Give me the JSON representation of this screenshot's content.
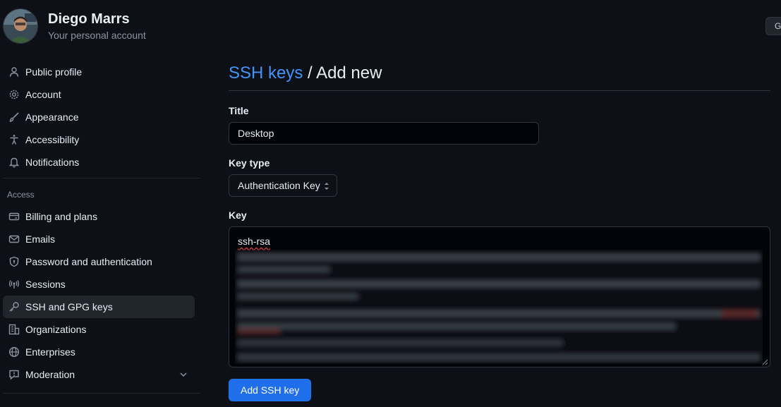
{
  "account": {
    "name": "Diego Marrs",
    "subtitle": "Your personal account"
  },
  "header": {
    "right_button_label": "G"
  },
  "sidebar": {
    "items": [
      {
        "label": "Public profile",
        "icon": "person-icon"
      },
      {
        "label": "Account",
        "icon": "gear-icon"
      },
      {
        "label": "Appearance",
        "icon": "paintbrush-icon"
      },
      {
        "label": "Accessibility",
        "icon": "accessibility-icon"
      },
      {
        "label": "Notifications",
        "icon": "bell-icon"
      }
    ],
    "section_label": "Access",
    "access_items": [
      {
        "label": "Billing and plans",
        "icon": "credit-card-icon"
      },
      {
        "label": "Emails",
        "icon": "mail-icon"
      },
      {
        "label": "Password and authentication",
        "icon": "shield-lock-icon"
      },
      {
        "label": "Sessions",
        "icon": "broadcast-icon"
      },
      {
        "label": "SSH and GPG keys",
        "icon": "key-icon",
        "active": true
      },
      {
        "label": "Organizations",
        "icon": "organization-icon"
      },
      {
        "label": "Enterprises",
        "icon": "globe-icon"
      },
      {
        "label": "Moderation",
        "icon": "report-icon",
        "expandable": true
      }
    ]
  },
  "main": {
    "breadcrumb_link": "SSH keys",
    "breadcrumb_separator": "/",
    "breadcrumb_current": "Add new",
    "title_label": "Title",
    "title_value": "Desktop",
    "keytype_label": "Key type",
    "keytype_value": "Authentication Key",
    "key_label": "Key",
    "key_prefix": "ssh-rsa",
    "submit_label": "Add SSH key"
  },
  "colors": {
    "background": "#0d1117",
    "accent_link": "#4493f8",
    "primary_button": "#1f6feb",
    "border": "#30363d",
    "muted_text": "#8b949e"
  }
}
